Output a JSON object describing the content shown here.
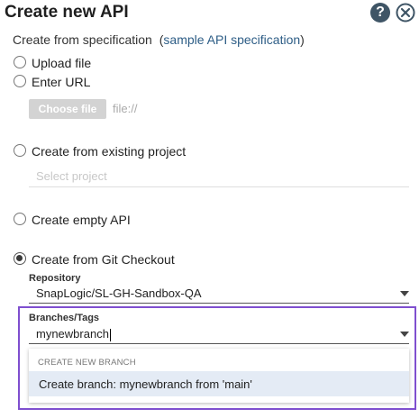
{
  "dialog": {
    "title": "Create new API"
  },
  "spec": {
    "prefix": "Create from specification",
    "open_paren": "(",
    "link": "sample API specification",
    "close_paren": ")"
  },
  "options": {
    "upload_file": "Upload file",
    "enter_url": "Enter URL",
    "existing_project": "Create from existing project",
    "empty_api": "Create empty API",
    "git_checkout": "Create from Git Checkout"
  },
  "url": {
    "choose_file_label": "Choose file",
    "placeholder": "file://"
  },
  "project": {
    "placeholder": "Select project"
  },
  "repository": {
    "label": "Repository",
    "value": "SnapLogic/SL-GH-Sandbox-QA"
  },
  "branches": {
    "label": "Branches/Tags",
    "value": "mynewbranch",
    "dropdown_header": "CREATE NEW BRANCH",
    "create_option": "Create branch: mynewbranch from 'main'"
  },
  "colors": {
    "accent": "#7f4fcf",
    "link": "#2d5d86",
    "option_highlight": "#e4ebf5",
    "help_icon_bg": "#3f5566"
  },
  "icons": {
    "help": "question-circle-icon",
    "close": "close-circle-icon",
    "caret": "caret-down-icon"
  }
}
